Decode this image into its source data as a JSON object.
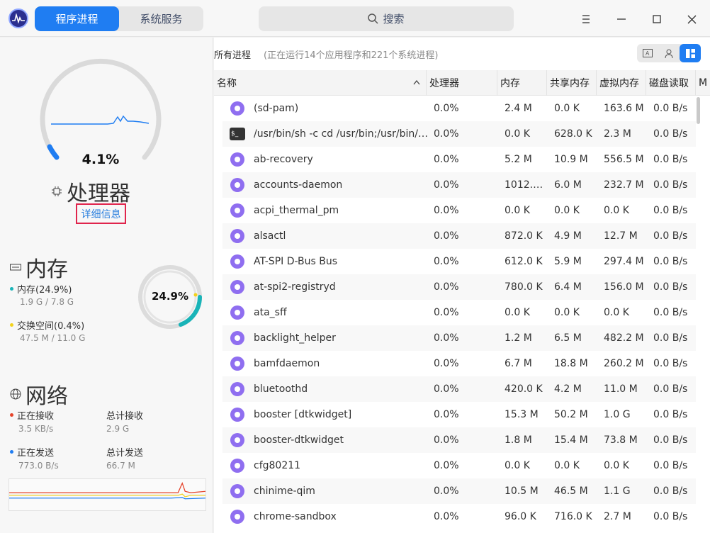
{
  "header": {
    "tabs": [
      {
        "label": "程序进程",
        "active": true
      },
      {
        "label": "系统服务",
        "active": false
      }
    ],
    "search_label": "搜索"
  },
  "cpu": {
    "percent_label": "4.1%",
    "percent_value": 4.1,
    "title": "处理器",
    "detail_link": "详细信息"
  },
  "memory": {
    "title": "内存",
    "percent_label": "24.9%",
    "mem_label": "内存(24.9%)",
    "mem_usage": "1.9 G / 7.8 G",
    "swap_label": "交换空间(0.4%)",
    "swap_usage": "47.5 M / 11.0 G",
    "mem_color": "#19b4b8",
    "swap_color": "#f2d21c"
  },
  "network": {
    "title": "网络",
    "recv_label": "正在接收",
    "recv_value": "3.5 KB/s",
    "total_recv_label": "总计接收",
    "total_recv_value": "2.9 G",
    "send_label": "正在发送",
    "send_value": "773.0 B/s",
    "total_send_label": "总计发送",
    "total_send_value": "66.7 M",
    "recv_color": "#e5442b",
    "send_color": "#1f7df2"
  },
  "process_panel": {
    "title": "所有进程",
    "subtitle": "(正在运行14个应用程序和221个系统进程)",
    "columns": [
      "名称",
      "处理器",
      "内存",
      "共享内存",
      "虚拟内存",
      "磁盘读取",
      "M"
    ],
    "rows": [
      {
        "icon": "app-icon",
        "name": "(sd-pam)",
        "cpu": "0.0%",
        "mem": "2.4 M",
        "shm": "0.0 K",
        "vmem": "163.6 M",
        "disk": "0.0 B/s"
      },
      {
        "icon": "terminal-icon",
        "name": "/usr/bin/sh -c cd /usr/bin;/usr/bin/…",
        "cpu": "0.0%",
        "mem": "0.0 K",
        "shm": "628.0 K",
        "vmem": "2.3 M",
        "disk": "0.0 B/s"
      },
      {
        "icon": "app-icon",
        "name": "ab-recovery",
        "cpu": "0.0%",
        "mem": "5.2 M",
        "shm": "10.9 M",
        "vmem": "556.5 M",
        "disk": "0.0 B/s"
      },
      {
        "icon": "app-icon",
        "name": "accounts-daemon",
        "cpu": "0.0%",
        "mem": "1012.…",
        "shm": "6.0 M",
        "vmem": "232.7 M",
        "disk": "0.0 B/s"
      },
      {
        "icon": "app-icon",
        "name": "acpi_thermal_pm",
        "cpu": "0.0%",
        "mem": "0.0 K",
        "shm": "0.0 K",
        "vmem": "0.0 K",
        "disk": "0.0 B/s"
      },
      {
        "icon": "app-icon",
        "name": "alsactl",
        "cpu": "0.0%",
        "mem": "872.0 K",
        "shm": "4.9 M",
        "vmem": "12.7 M",
        "disk": "0.0 B/s"
      },
      {
        "icon": "app-icon",
        "name": "AT-SPI D-Bus Bus",
        "cpu": "0.0%",
        "mem": "612.0 K",
        "shm": "5.9 M",
        "vmem": "297.4 M",
        "disk": "0.0 B/s"
      },
      {
        "icon": "app-icon",
        "name": "at-spi2-registryd",
        "cpu": "0.0%",
        "mem": "780.0 K",
        "shm": "6.4 M",
        "vmem": "156.0 M",
        "disk": "0.0 B/s"
      },
      {
        "icon": "app-icon",
        "name": "ata_sff",
        "cpu": "0.0%",
        "mem": "0.0 K",
        "shm": "0.0 K",
        "vmem": "0.0 K",
        "disk": "0.0 B/s"
      },
      {
        "icon": "app-icon",
        "name": "backlight_helper",
        "cpu": "0.0%",
        "mem": "1.2 M",
        "shm": "6.5 M",
        "vmem": "482.2 M",
        "disk": "0.0 B/s"
      },
      {
        "icon": "app-icon",
        "name": "bamfdaemon",
        "cpu": "0.0%",
        "mem": "6.7 M",
        "shm": "18.8 M",
        "vmem": "260.2 M",
        "disk": "0.0 B/s"
      },
      {
        "icon": "app-icon",
        "name": "bluetoothd",
        "cpu": "0.0%",
        "mem": "420.0 K",
        "shm": "4.2 M",
        "vmem": "11.0 M",
        "disk": "0.0 B/s"
      },
      {
        "icon": "app-icon",
        "name": "booster [dtkwidget]",
        "cpu": "0.0%",
        "mem": "15.3 M",
        "shm": "50.2 M",
        "vmem": "1.0 G",
        "disk": "0.0 B/s"
      },
      {
        "icon": "app-icon",
        "name": "booster-dtkwidget",
        "cpu": "0.0%",
        "mem": "1.8 M",
        "shm": "15.4 M",
        "vmem": "73.8 M",
        "disk": "0.0 B/s"
      },
      {
        "icon": "app-icon",
        "name": "cfg80211",
        "cpu": "0.0%",
        "mem": "0.0 K",
        "shm": "0.0 K",
        "vmem": "0.0 K",
        "disk": "0.0 B/s"
      },
      {
        "icon": "app-icon",
        "name": "chinime-qim",
        "cpu": "0.0%",
        "mem": "10.5 M",
        "shm": "46.5 M",
        "vmem": "1.1 G",
        "disk": "0.0 B/s"
      },
      {
        "icon": "app-icon",
        "name": "chrome-sandbox",
        "cpu": "0.0%",
        "mem": "96.0 K",
        "shm": "716.0 K",
        "vmem": "2.7 M",
        "disk": "0.0 B/s"
      }
    ]
  },
  "accent_color": "#1f7df2"
}
